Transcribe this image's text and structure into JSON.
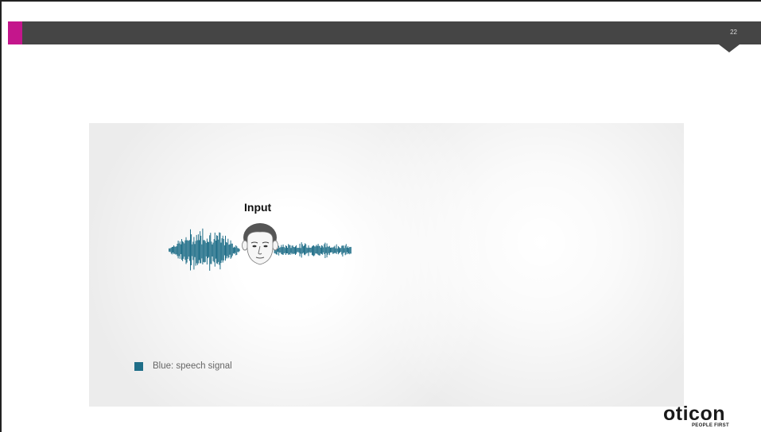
{
  "header": {
    "page_number": "22"
  },
  "diagram": {
    "input_label": "Input"
  },
  "legend": {
    "label": "Blue: speech signal",
    "swatch_color": "#1f6e88"
  },
  "brand": {
    "name": "oticon",
    "tagline": "PEOPLE FIRST"
  },
  "colors": {
    "header_bar": "#454545",
    "accent": "#c4168c",
    "speech_signal": "#1f6e88"
  },
  "icons": [
    "head-icon",
    "waveform-icon"
  ]
}
